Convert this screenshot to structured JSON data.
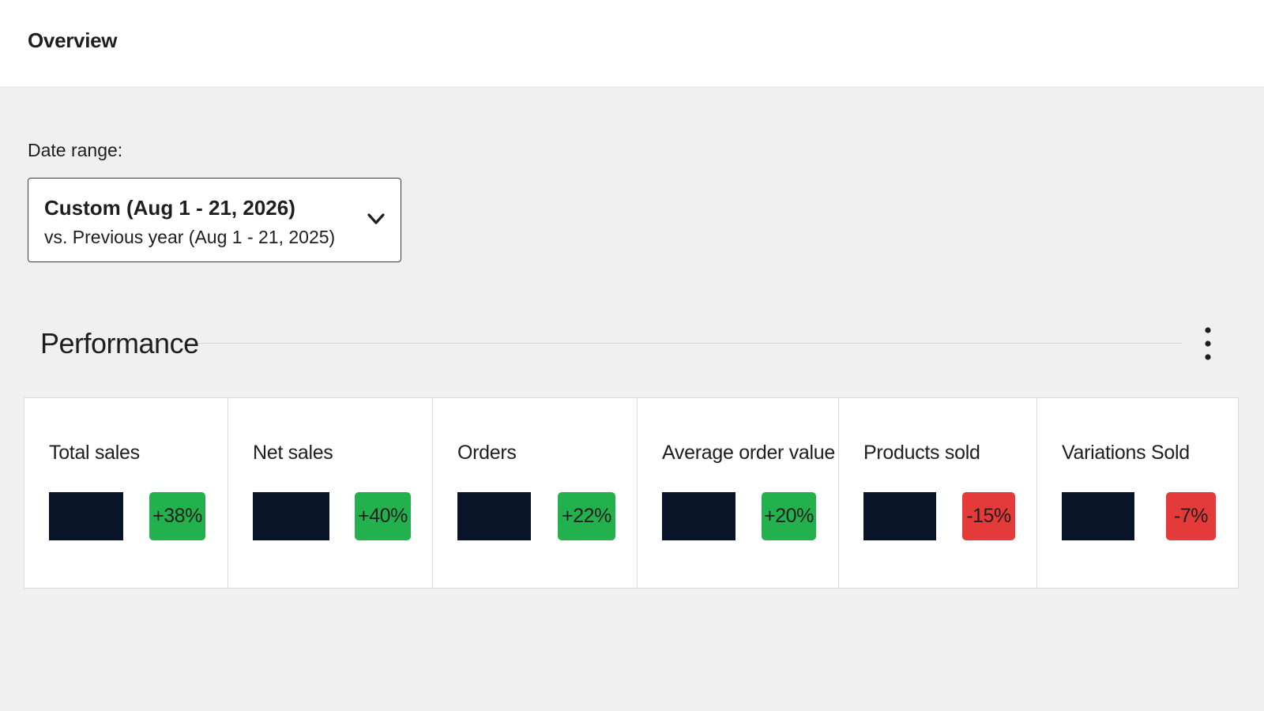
{
  "header": {
    "title": "Overview"
  },
  "date_range": {
    "label": "Date range:",
    "primary": "Custom (Aug 1 - 21, 2026)",
    "secondary": "vs. Previous year (Aug 1 - 21, 2025)",
    "icon": "chevron-down-icon"
  },
  "performance": {
    "title": "Performance",
    "menu_icon": "vertical-ellipsis-icon",
    "cards": [
      {
        "label": "Total sales",
        "delta": "+38%",
        "trend": "up"
      },
      {
        "label": "Net sales",
        "delta": "+40%",
        "trend": "up"
      },
      {
        "label": "Orders",
        "delta": "+22%",
        "trend": "up"
      },
      {
        "label": "Average order value",
        "delta": "+20%",
        "trend": "up"
      },
      {
        "label": "Products sold",
        "delta": "-15%",
        "trend": "down"
      },
      {
        "label": "Variations Sold",
        "delta": "-7%",
        "trend": "down"
      }
    ]
  },
  "colors": {
    "positive": "#22b14c",
    "negative": "#e53a3a",
    "redacted_value": "#0a1428"
  }
}
